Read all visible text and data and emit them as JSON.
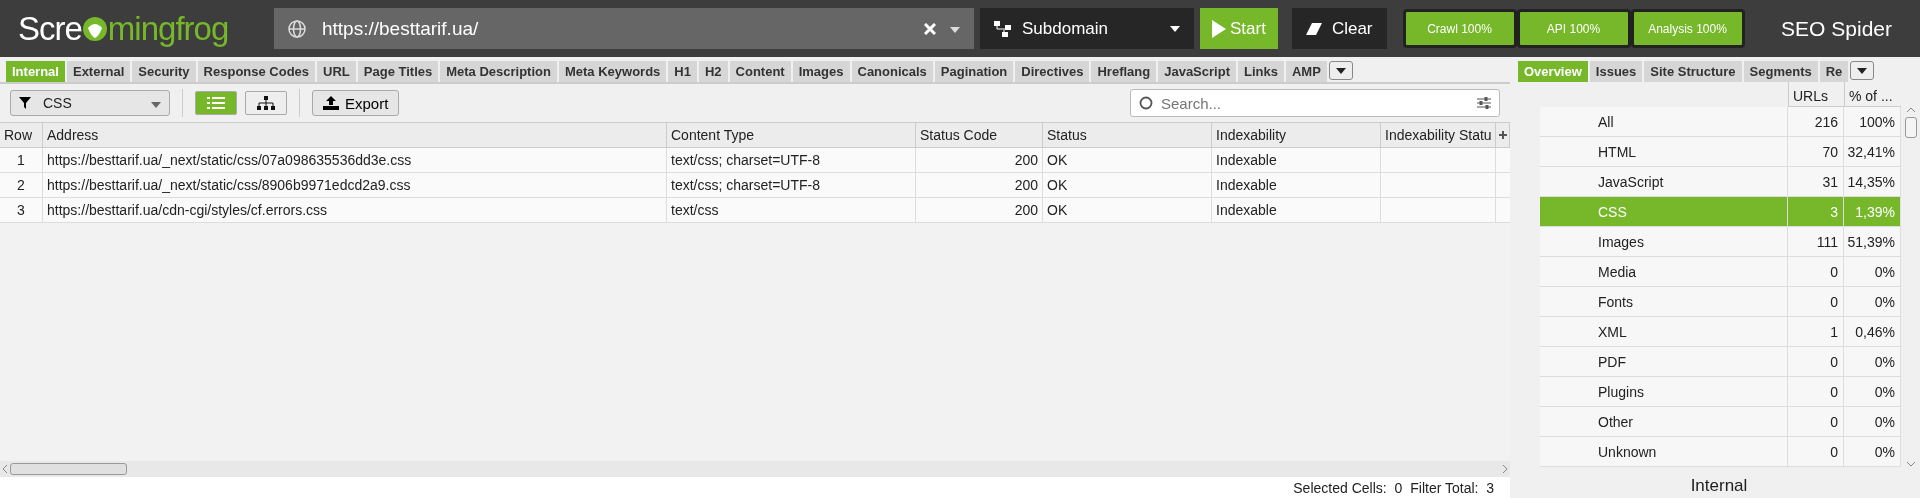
{
  "app": {
    "logo_left": "Scre",
    "logo_right": "mingfrog",
    "product": "SEO Spider"
  },
  "url_field": {
    "value": "https://besttarif.ua/"
  },
  "mode_dropdown": {
    "value": "Subdomain"
  },
  "buttons": {
    "start": "Start",
    "clear": "Clear"
  },
  "progress": [
    {
      "label": "Crawl 100%"
    },
    {
      "label": "API 100%"
    },
    {
      "label": "Analysis 100%"
    }
  ],
  "tabs": [
    {
      "label": "Internal",
      "selected": true
    },
    {
      "label": "External",
      "selected": false
    },
    {
      "label": "Security",
      "selected": false
    },
    {
      "label": "Response Codes",
      "selected": false
    },
    {
      "label": "URL",
      "selected": false
    },
    {
      "label": "Page Titles",
      "selected": false
    },
    {
      "label": "Meta Description",
      "selected": false
    },
    {
      "label": "Meta Keywords",
      "selected": false
    },
    {
      "label": "H1",
      "selected": false
    },
    {
      "label": "H2",
      "selected": false
    },
    {
      "label": "Content",
      "selected": false
    },
    {
      "label": "Images",
      "selected": false
    },
    {
      "label": "Canonicals",
      "selected": false
    },
    {
      "label": "Pagination",
      "selected": false
    },
    {
      "label": "Directives",
      "selected": false
    },
    {
      "label": "Hreflang",
      "selected": false
    },
    {
      "label": "JavaScript",
      "selected": false
    },
    {
      "label": "Links",
      "selected": false
    },
    {
      "label": "AMP",
      "selected": false
    }
  ],
  "filter": {
    "value": "CSS"
  },
  "views": [
    {
      "kind": "list",
      "selected": true
    },
    {
      "kind": "tree",
      "selected": false
    }
  ],
  "export_button": "Export",
  "search": {
    "placeholder": "Search..."
  },
  "table": {
    "columns": [
      "Row",
      "Address",
      "Content Type",
      "Status Code",
      "Status",
      "Indexability",
      "Indexability Statu"
    ],
    "rows": [
      [
        "1",
        "https://besttarif.ua/_next/static/css/07a098635536dd3e.css",
        "text/css; charset=UTF-8",
        "200",
        "OK",
        "Indexable"
      ],
      [
        "2",
        "https://besttarif.ua/_next/static/css/8906b9971edcd2a9.css",
        "text/css; charset=UTF-8",
        "200",
        "OK",
        "Indexable"
      ],
      [
        "3",
        "https://besttarif.ua/cdn-cgi/styles/cf.errors.css",
        "text/css",
        "200",
        "OK",
        "Indexable"
      ]
    ]
  },
  "status_bar": [
    "Selected Cells:  0",
    "Filter Total:  3"
  ],
  "right_tabs": [
    {
      "label": "Overview",
      "selected": true
    },
    {
      "label": "Issues",
      "selected": false
    },
    {
      "label": "Site Structure",
      "selected": false
    },
    {
      "label": "Segments",
      "selected": false
    },
    {
      "label": "Re",
      "selected": false
    }
  ],
  "overview": {
    "columns": [
      "URLs",
      "% of ..."
    ],
    "rows": [
      {
        "label": "All",
        "urls": "216",
        "pct": "100%",
        "selected": false
      },
      {
        "label": "HTML",
        "urls": "70",
        "pct": "32,41%",
        "selected": false
      },
      {
        "label": "JavaScript",
        "urls": "31",
        "pct": "14,35%",
        "selected": false
      },
      {
        "label": "CSS",
        "urls": "3",
        "pct": "1,39%",
        "selected": true
      },
      {
        "label": "Images",
        "urls": "111",
        "pct": "51,39%",
        "selected": false
      },
      {
        "label": "Media",
        "urls": "0",
        "pct": "0%",
        "selected": false
      },
      {
        "label": "Fonts",
        "urls": "0",
        "pct": "0%",
        "selected": false
      },
      {
        "label": "XML",
        "urls": "1",
        "pct": "0,46%",
        "selected": false
      },
      {
        "label": "PDF",
        "urls": "0",
        "pct": "0%",
        "selected": false
      },
      {
        "label": "Plugins",
        "urls": "0",
        "pct": "0%",
        "selected": false
      },
      {
        "label": "Other",
        "urls": "0",
        "pct": "0%",
        "selected": false
      },
      {
        "label": "Unknown",
        "urls": "0",
        "pct": "0%",
        "selected": false
      }
    ],
    "footer_title": "Internal"
  }
}
